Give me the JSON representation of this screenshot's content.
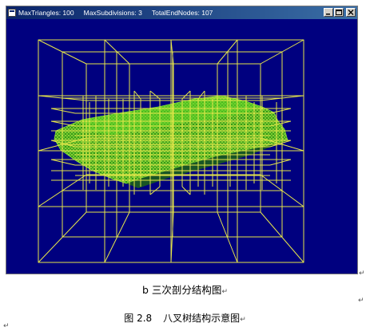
{
  "window": {
    "title_segments": [
      "MaxTriangles: 100",
      "MaxSubdivisions: 3",
      "TotalEndNodes: 107"
    ],
    "controls": [
      "minimize",
      "maximize",
      "close"
    ],
    "background_color": "#000080",
    "wireframe_color": "#e6e64a",
    "mesh_color": "#4fd21e"
  },
  "captions": {
    "subfigure": "b  三次剖分结构图",
    "figure_number": "图 2.8",
    "figure_title": "八叉树结构示意图",
    "paragraph_mark": "↵"
  }
}
